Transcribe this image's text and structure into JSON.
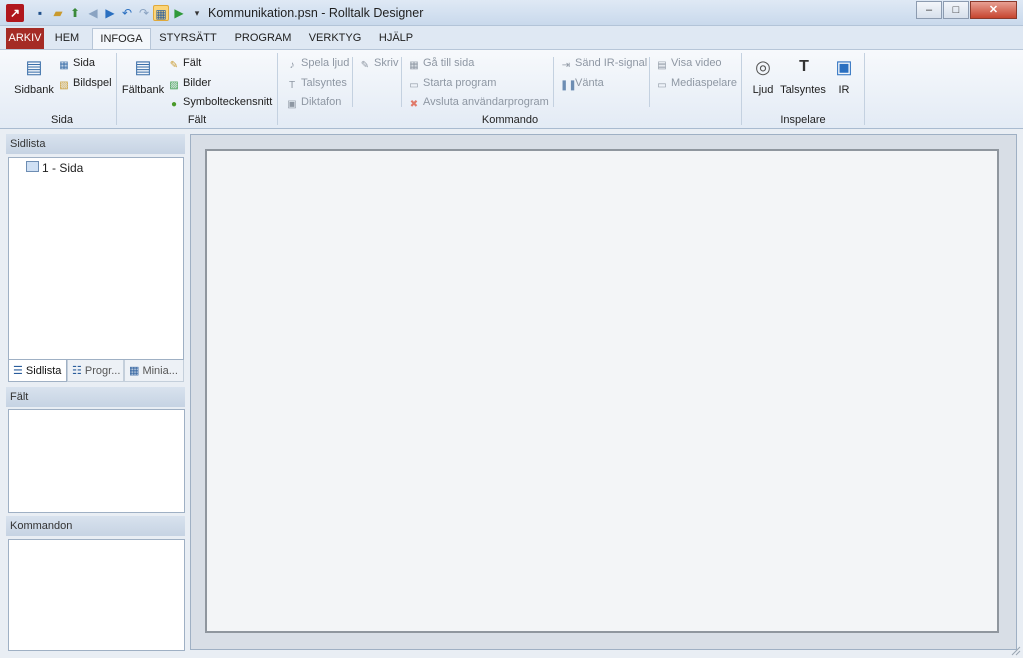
{
  "window": {
    "title": "Kommunikation.psn - Rolltalk Designer",
    "controls": [
      "–",
      "□",
      "✕"
    ]
  },
  "quick_access": [
    {
      "icon": "save-icon",
      "glyph": "💾"
    },
    {
      "icon": "open-folder-icon",
      "glyph": "📂"
    },
    {
      "icon": "export-icon",
      "glyph": "⇪"
    },
    {
      "icon": "back-icon",
      "glyph": "◀"
    },
    {
      "icon": "forward-icon",
      "glyph": "▶"
    },
    {
      "icon": "undo-icon",
      "glyph": "↶"
    },
    {
      "icon": "redo-icon",
      "glyph": "↷"
    },
    {
      "icon": "design-mode-icon",
      "glyph": "▦"
    },
    {
      "icon": "play-icon",
      "glyph": "▶"
    },
    {
      "icon": "customize-dropdown-icon",
      "glyph": "▾"
    }
  ],
  "tabs": [
    "ARKIV",
    "HEM",
    "INFOGA",
    "STYRSÄTT",
    "PROGRAM",
    "VERKTYG",
    "HJÄLP"
  ],
  "active_tab": "INFOGA",
  "ribbon": {
    "sida": {
      "label": "Sida",
      "big": {
        "label": "Sidbank",
        "icon": "page-bank-icon"
      },
      "small": [
        {
          "label": "Sida",
          "icon": "page-icon"
        },
        {
          "label": "Bildspel",
          "icon": "slideshow-icon"
        }
      ]
    },
    "falt": {
      "label": "Fält",
      "big": {
        "label": "Fältbank",
        "icon": "field-bank-icon"
      },
      "small": [
        {
          "label": "Fält",
          "icon": "field-icon"
        },
        {
          "label": "Bilder",
          "icon": "images-icon"
        },
        {
          "label": "Symbolteckensnitt",
          "icon": "symbol-font-icon"
        }
      ]
    },
    "kommando": {
      "label": "Kommando",
      "col1": [
        {
          "label": "Spela ljud",
          "icon": "play-sound-icon"
        },
        {
          "label": "Talsyntes",
          "icon": "speech-synthesis-icon"
        },
        {
          "label": "Diktafon",
          "icon": "dictaphone-icon"
        }
      ],
      "col2": [
        {
          "label": "Skriv",
          "icon": "write-icon"
        }
      ],
      "col3": [
        {
          "label": "Gå till sida",
          "icon": "goto-page-icon"
        },
        {
          "label": "Starta program",
          "icon": "start-program-icon"
        },
        {
          "label": "Avsluta användarprogram",
          "icon": "exit-program-icon"
        }
      ],
      "col4": [
        {
          "label": "Sänd IR-signal",
          "icon": "send-ir-icon"
        },
        {
          "label": "Vänta",
          "icon": "wait-icon"
        }
      ],
      "col5": [
        {
          "label": "Visa video",
          "icon": "video-icon"
        },
        {
          "label": "Mediaspelare",
          "icon": "media-player-icon"
        }
      ]
    },
    "inspelare": {
      "label": "Inspelare",
      "big": [
        {
          "label": "Ljud",
          "icon": "record-sound-icon"
        },
        {
          "label": "Talsyntes",
          "icon": "record-tts-icon"
        },
        {
          "label": "IR",
          "icon": "record-ir-icon"
        }
      ]
    }
  },
  "panels": {
    "sidlista": {
      "title": "Sidlista",
      "items": [
        "1 - Sida"
      ],
      "tabs": [
        "Sidlista",
        "Progr...",
        "Minia..."
      ]
    },
    "falt": {
      "title": "Fält"
    },
    "kommandon": {
      "title": "Kommandon"
    }
  },
  "colors": {
    "file_tab": "#a52b25",
    "ribbon_bg": "#eef3f9",
    "accent": "#2a5d9c"
  }
}
